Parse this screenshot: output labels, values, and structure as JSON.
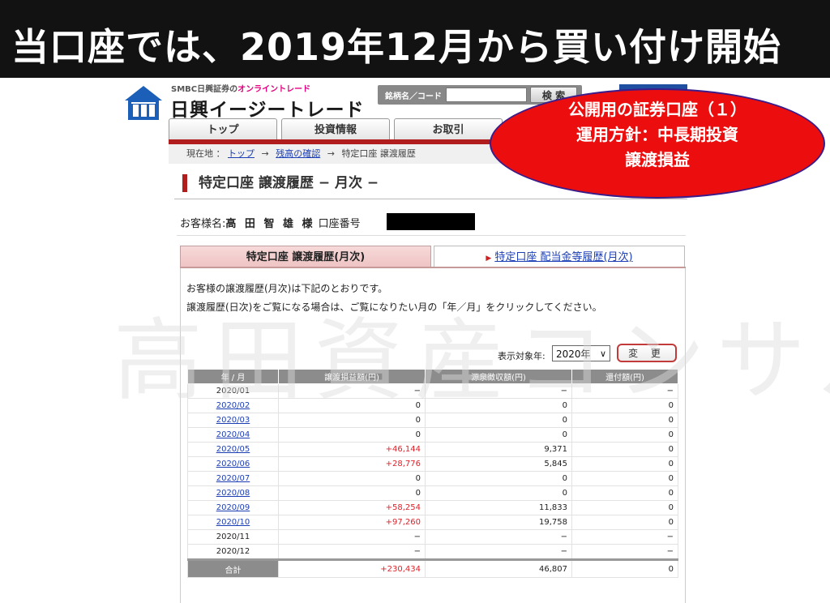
{
  "banner": {
    "title": "当口座では、2019年12月から買い付け開始"
  },
  "watermark": "高田資産コンサル",
  "logo": {
    "small_prefix": "SMBC日興証券の",
    "small_accent": "オンライントレード",
    "main": "日興イージートレード"
  },
  "search": {
    "label": "銘柄名／コード",
    "value": "",
    "button": "検 索"
  },
  "nav_tabs": [
    "トップ",
    "投資情報",
    "お取引"
  ],
  "breadcrumb": {
    "prefix": "現在地 ：",
    "items": [
      "トップ",
      "残高の確認"
    ],
    "current": "特定口座 譲渡履歴",
    "arrow": "→"
  },
  "page_title": "特定口座 譲渡履歴 − 月次 −",
  "customer": {
    "label": "お客様名:",
    "name": "高 田  智 雄 様",
    "account_label": "口座番号"
  },
  "subtabs": {
    "active": "特定口座 譲渡履歴(月次)",
    "inactive": "特定口座 配当金等履歴(月次)"
  },
  "description": [
    "お客様の譲渡履歴(月次)は下記のとおりです。",
    "譲渡履歴(日次)をご覧になる場合は、ご覧になりたい月の「年／月」をクリックしてください。"
  ],
  "year_filter": {
    "label": "表示対象年:",
    "value": "2020年",
    "button": "変 更"
  },
  "table": {
    "headers": [
      "年 / 月",
      "譲渡損益額(円)",
      "源泉徴収額(円)",
      "還付額(円)"
    ],
    "rows": [
      {
        "ym": "2020/01",
        "link": false,
        "gain": "−",
        "withholding": "−",
        "refund": "−"
      },
      {
        "ym": "2020/02",
        "link": true,
        "gain": "0",
        "withholding": "0",
        "refund": "0"
      },
      {
        "ym": "2020/03",
        "link": true,
        "gain": "0",
        "withholding": "0",
        "refund": "0"
      },
      {
        "ym": "2020/04",
        "link": true,
        "gain": "0",
        "withholding": "0",
        "refund": "0"
      },
      {
        "ym": "2020/05",
        "link": true,
        "gain": "+46,144",
        "withholding": "9,371",
        "refund": "0"
      },
      {
        "ym": "2020/06",
        "link": true,
        "gain": "+28,776",
        "withholding": "5,845",
        "refund": "0"
      },
      {
        "ym": "2020/07",
        "link": true,
        "gain": "0",
        "withholding": "0",
        "refund": "0"
      },
      {
        "ym": "2020/08",
        "link": true,
        "gain": "0",
        "withholding": "0",
        "refund": "0"
      },
      {
        "ym": "2020/09",
        "link": true,
        "gain": "+58,254",
        "withholding": "11,833",
        "refund": "0"
      },
      {
        "ym": "2020/10",
        "link": true,
        "gain": "+97,260",
        "withholding": "19,758",
        "refund": "0"
      },
      {
        "ym": "2020/11",
        "link": false,
        "gain": "−",
        "withholding": "−",
        "refund": "−"
      },
      {
        "ym": "2020/12",
        "link": false,
        "gain": "−",
        "withholding": "−",
        "refund": "−"
      }
    ],
    "total": {
      "ym": "合計",
      "gain": "+230,434",
      "withholding": "46,807",
      "refund": "0"
    }
  },
  "callout": {
    "lines": [
      "公開用の証券口座（１）",
      "運用方針：中長期投資",
      "譲渡損益"
    ],
    "fill": "#ec0e0e",
    "border": "#3a1c8a"
  },
  "colors": {
    "accent": "#b11d1d",
    "positive": "#e0222a",
    "link": "#1b3eb5"
  }
}
